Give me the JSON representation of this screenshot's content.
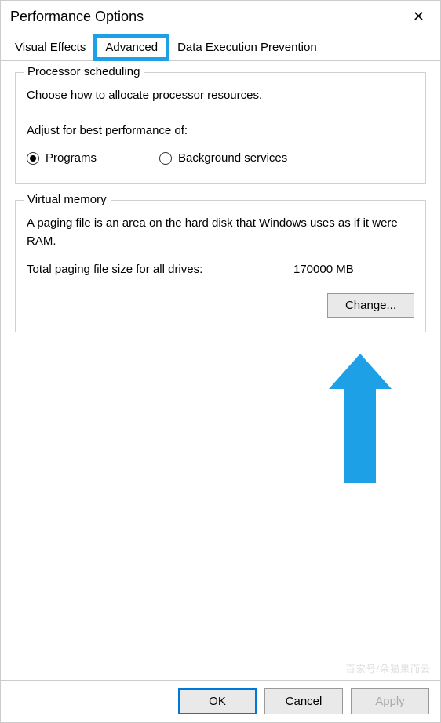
{
  "title": "Performance Options",
  "tabs": {
    "visual_effects": "Visual Effects",
    "advanced": "Advanced",
    "dep": "Data Execution Prevention"
  },
  "processor_scheduling": {
    "group_title": "Processor scheduling",
    "description": "Choose how to allocate processor resources.",
    "adjust_label": "Adjust for best performance of:",
    "option_programs": "Programs",
    "option_background": "Background services"
  },
  "virtual_memory": {
    "group_title": "Virtual memory",
    "description": "A paging file is an area on the hard disk that Windows uses as if it were RAM.",
    "total_label": "Total paging file size for all drives:",
    "total_value": "170000 MB",
    "change_button": "Change..."
  },
  "footer": {
    "ok": "OK",
    "cancel": "Cancel",
    "apply": "Apply"
  },
  "watermark": "百家号/朵猫果而云"
}
